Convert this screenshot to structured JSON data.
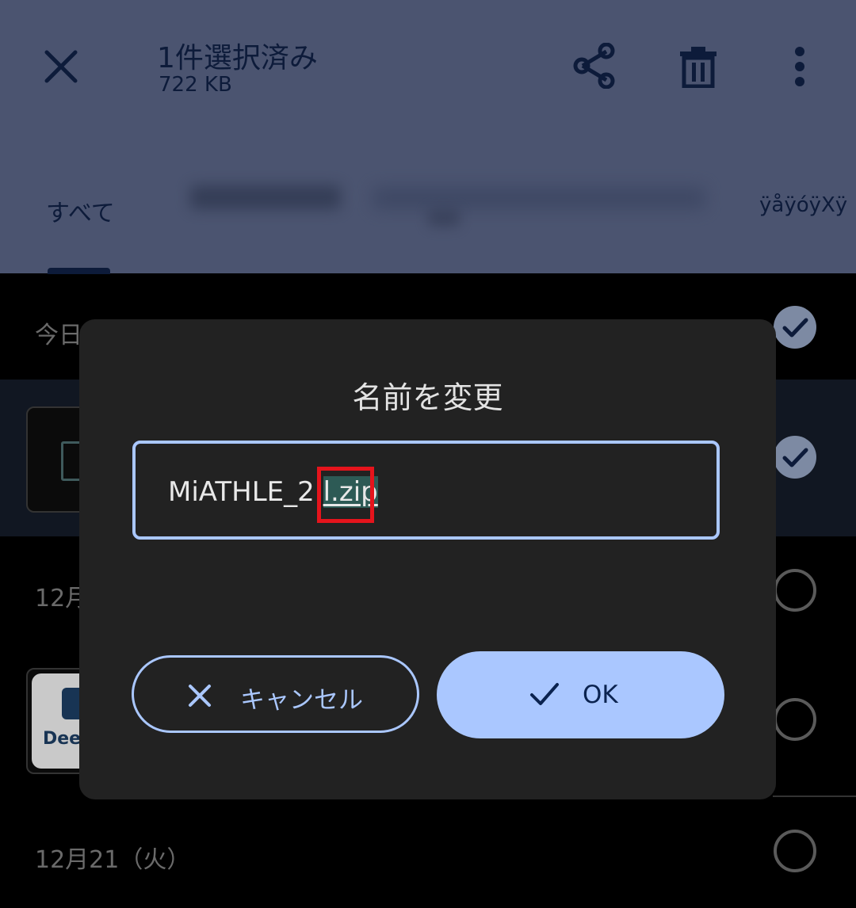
{
  "header": {
    "selection_title": "1件選択済み",
    "selection_size": "722 KB",
    "tab_all": "すべて",
    "tab_garbled": "ÿåÿóÿXÿ"
  },
  "list": {
    "date_today": "今日",
    "date_dec": "12月",
    "date_dec21": "12月21（火）",
    "deep_thumb_text": "Dee"
  },
  "dialog": {
    "title": "名前を変更",
    "filename_prefix": "MiATHLE_2.",
    "filename_selected": "l.zip",
    "cancel_label": "キャンセル",
    "ok_label": "OK"
  },
  "colors": {
    "accent": "#aac7ff",
    "annotation": "#e5141c",
    "dialog_bg": "#222222"
  }
}
